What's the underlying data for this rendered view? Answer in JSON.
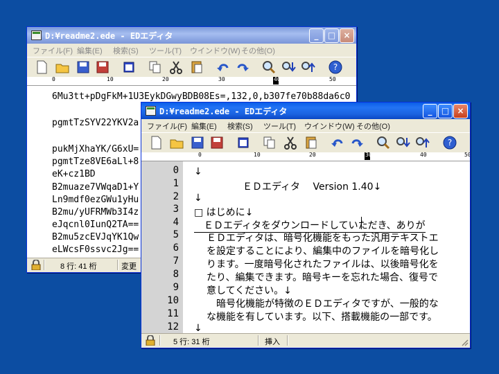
{
  "back_window": {
    "title": "D:¥readme2.ede - EDエディタ",
    "menu": [
      "ファイル(F)",
      "編集(E)",
      "検索(S)",
      "ツール(T)",
      "ウインドウ(W)",
      "その他(O)"
    ],
    "ruler": [
      "0",
      "10",
      "20",
      "30",
      "40",
      "50"
    ],
    "lines": [
      "6Mu3tt+pDgFkM+1U3EykDGwyBDB08Es=,132,0,b307fe70b88da6c0",
      "",
      "pgmtTzSYV22YKV2a",
      "",
      "pukMjXhaYK/G6xU=",
      "pgmtTze8VE6aLl+8",
      "eK+cz1BD",
      "B2muaze7VWqaD1+Y",
      "Ln9mdf0ezGWu1yHu",
      "B2mu/yUFRMWb3I4z",
      "eJqcnl0IunQ2TA==",
      "B2mu5zcEVJqYK1Qw",
      "eLWcsF0ssvc2Jg=="
    ],
    "status": {
      "position": "8 行: 41 桁",
      "mode": "変更"
    }
  },
  "front_window": {
    "title": "D:¥readme2.ede - EDエディタ",
    "menu": [
      "ファイル(F)",
      "編集(E)",
      "検索(S)",
      "ツール(T)",
      "ウインドウ(W)",
      "その他(O)"
    ],
    "ruler": [
      "0",
      "10",
      "20",
      "30",
      "40",
      "50"
    ],
    "line_numbers": [
      "0",
      "1",
      "2",
      "3",
      "4",
      "5",
      "6",
      "7",
      "8",
      "9",
      "10",
      "11",
      "12"
    ],
    "lines": [
      "↓",
      "　　　　　ＥＤエディタ　 Version 1.40↓",
      "↓",
      "□ はじめに↓",
      "　ＥＤエディタをダウンロードしていただき、ありが",
      "ＥＤエディタは、暗号化機能をもった汎用テキストエ",
      "を設定することにより、編集中のファイルを暗号化し",
      "ります。一度暗号化されたファイルは、以後暗号化を",
      "たり、編集できます。暗号キーを忘れた場合、復号で",
      "意してください。↓",
      "　暗号化機能が特徴のＥＤエディタですが、一般的な",
      "な機能を有しています。以下、搭載機能の一部です。",
      "↓"
    ],
    "status": {
      "position": "5 行: 31 桁",
      "mode": "挿入"
    }
  },
  "toolbar_icons": [
    "new-file-icon",
    "open-folder-icon",
    "save-icon",
    "save-all-icon",
    "window-icon",
    "copy-icon",
    "cut-icon",
    "paste-icon",
    "undo-icon",
    "redo-icon",
    "find-icon",
    "find-next-icon",
    "find-prev-icon",
    "help-icon"
  ],
  "colors": {
    "desktop": "#0c4da2",
    "titlebar_active": "#0a5ee8",
    "gutter": "#d4d4d4"
  }
}
